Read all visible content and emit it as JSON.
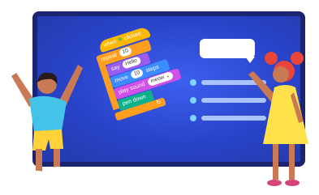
{
  "scene": {
    "code_blocks": [
      {
        "name": "when-flag-clicked-block",
        "pre": "when",
        "post": "clicked"
      },
      {
        "name": "repeat-block",
        "pre": "repeat",
        "value": "10"
      },
      {
        "name": "say-block",
        "pre": "say",
        "value": "Hello"
      },
      {
        "name": "move-block",
        "pre": "move",
        "value": "10",
        "post": "steps"
      },
      {
        "name": "play-sound-block",
        "pre": "play sound",
        "value": "meow"
      },
      {
        "name": "pen-down-block",
        "pre": "pen down"
      }
    ],
    "colors": {
      "board": "#243fc0",
      "board_border": "#1a2470",
      "hat_block": "#ffb800",
      "repeat_block": "#ff9e1f",
      "say_block": "#9b5cf0",
      "move_block": "#3d8cff",
      "sound_block": "#d150e8",
      "pen_block": "#0fb08a"
    },
    "icons": {
      "flag": "green-flag-icon",
      "loop_arrow": "loop-arrow-icon",
      "dropdown": "chevron-down-icon"
    }
  }
}
